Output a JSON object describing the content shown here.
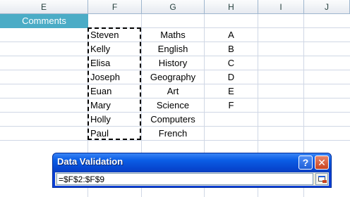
{
  "columns": [
    "E",
    "F",
    "G",
    "H",
    "I",
    "J"
  ],
  "comments_label": "Comments",
  "names": [
    "Steven",
    "Kelly",
    "Elisa",
    "Joseph",
    "Euan",
    "Mary",
    "Holly",
    "Paul"
  ],
  "subjects": [
    "Maths",
    "English",
    "History",
    "Geography",
    "Art",
    "Science",
    "Computers",
    "French"
  ],
  "grades": [
    "A",
    "B",
    "C",
    "D",
    "E",
    "F"
  ],
  "dialog": {
    "title": "Data Validation",
    "help_label": "?",
    "close_label": "✕",
    "reference_value": "=$F$2:$F$9",
    "collapse_icon": "collapse-dialog-icon"
  },
  "colors": {
    "header_fill": "#4bacc6",
    "title_bar": "#0b5ee6",
    "close_button": "#c9431f"
  }
}
